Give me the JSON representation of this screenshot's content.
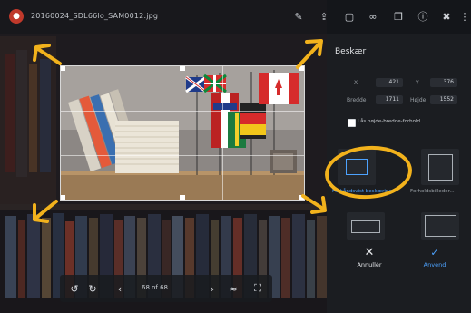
{
  "colors": {
    "annotation": "#f2b21c",
    "accent": "#4da3ff",
    "panel": "#1b1d21"
  },
  "topbar": {
    "filename": "20160024_SDL66lo_SAM0012.jpg",
    "icons": [
      "pencil-icon",
      "upload-icon",
      "info-icon",
      "link-icon",
      "copy-icon",
      "circle-info-icon",
      "trash-icon",
      "more-icon"
    ]
  },
  "panel": {
    "title": "Beskær",
    "fields": {
      "x_label": "X",
      "x_value": "421",
      "y_label": "Y",
      "y_value": "376",
      "width_label": "Bredde",
      "width_value": "1711",
      "height_label": "Højde",
      "height_value": "1552"
    },
    "lock_label": "Lås højde-bredde-forhold",
    "presets": [
      {
        "label": "Forhåndsvist beskæring"
      },
      {
        "label": "Forholdsbilleder..."
      },
      {
        "label": ""
      },
      {
        "label": ""
      }
    ],
    "cancel_label": "Annullér",
    "apply_label": "Anvend"
  },
  "bottombar": {
    "counter": "68 of 68"
  }
}
